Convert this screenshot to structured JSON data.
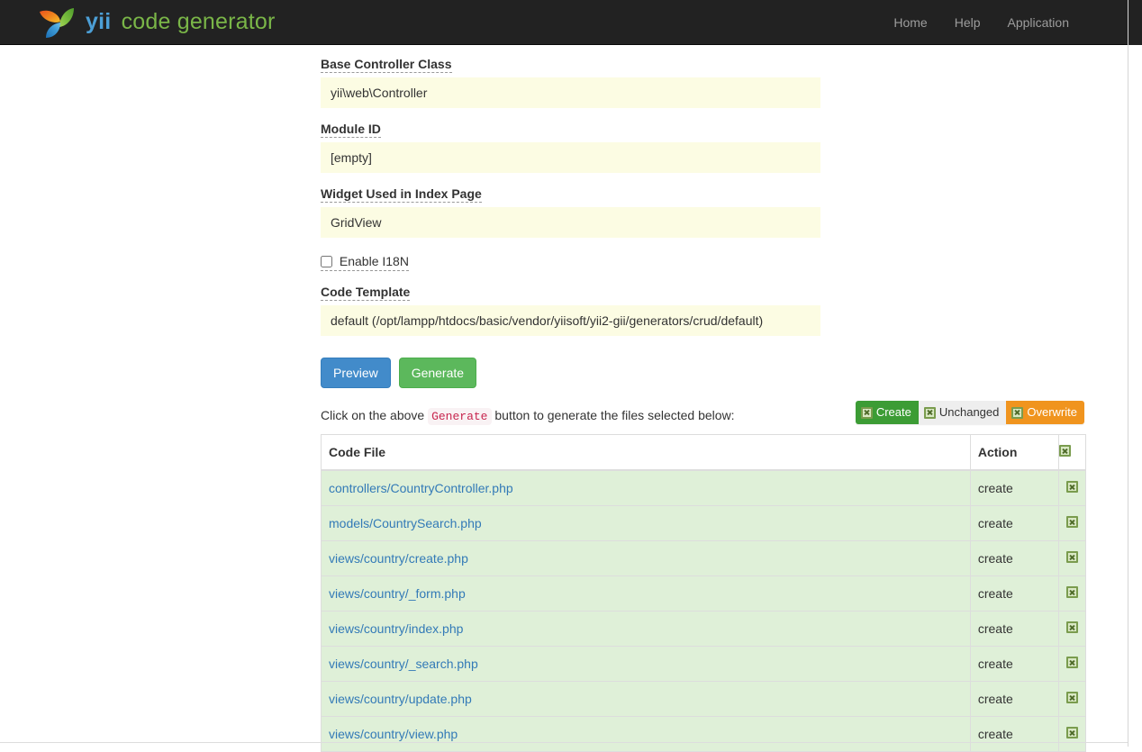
{
  "navbar": {
    "brand": {
      "primary": "yii",
      "secondary": "code generator",
      "logo_icon": "yii-logo-icon"
    },
    "links": [
      {
        "label": "Home",
        "name": "nav-link-home"
      },
      {
        "label": "Help",
        "name": "nav-link-help"
      },
      {
        "label": "Application",
        "name": "nav-link-application"
      }
    ]
  },
  "form": {
    "fields": [
      {
        "label": "Base Controller Class",
        "value": "yii\\web\\Controller"
      },
      {
        "label": "Module ID",
        "value": "[empty]"
      },
      {
        "label": "Widget Used in Index Page",
        "value": "GridView"
      }
    ],
    "checkbox": {
      "label": "Enable I18N",
      "checked": false
    },
    "template": {
      "label": "Code Template",
      "value": "default (/opt/lampp/htdocs/basic/vendor/yiisoft/yii2-gii/generators/crud/default)"
    },
    "buttons": {
      "preview": "Preview",
      "generate": "Generate"
    }
  },
  "hint": {
    "before": "Click on the above ",
    "code": "Generate",
    "after": " button to generate the files selected below:"
  },
  "legend": [
    {
      "label": "Create",
      "color": "#3c9c35",
      "icon": "broken-image-icon"
    },
    {
      "label": "Unchanged",
      "color": "#eeeeee",
      "icon": "broken-image-icon"
    },
    {
      "label": "Overwrite",
      "color": "#f0941e",
      "icon": "broken-image-icon"
    }
  ],
  "table": {
    "headers": {
      "file": "Code File",
      "action": "Action",
      "check": "broken-image-icon"
    },
    "rows": [
      {
        "file": "controllers/CountryController.php",
        "action": "create",
        "status": "create"
      },
      {
        "file": "models/CountrySearch.php",
        "action": "create",
        "status": "create"
      },
      {
        "file": "views/country/create.php",
        "action": "create",
        "status": "create"
      },
      {
        "file": "views/country/_form.php",
        "action": "create",
        "status": "create"
      },
      {
        "file": "views/country/index.php",
        "action": "create",
        "status": "create"
      },
      {
        "file": "views/country/_search.php",
        "action": "create",
        "status": "create"
      },
      {
        "file": "views/country/update.php",
        "action": "create",
        "status": "create"
      },
      {
        "file": "views/country/view.php",
        "action": "create",
        "status": "create"
      }
    ]
  },
  "colors": {
    "navbar_bg": "#222222",
    "brand_blue": "#4c9fd6",
    "brand_green": "#7ab648",
    "input_bg": "#fcfce3",
    "row_create_bg": "#dff0d8",
    "link_blue": "#337ab7",
    "btn_primary": "#428bca",
    "btn_success": "#5cb85c",
    "code_pink": "#c7254e"
  }
}
